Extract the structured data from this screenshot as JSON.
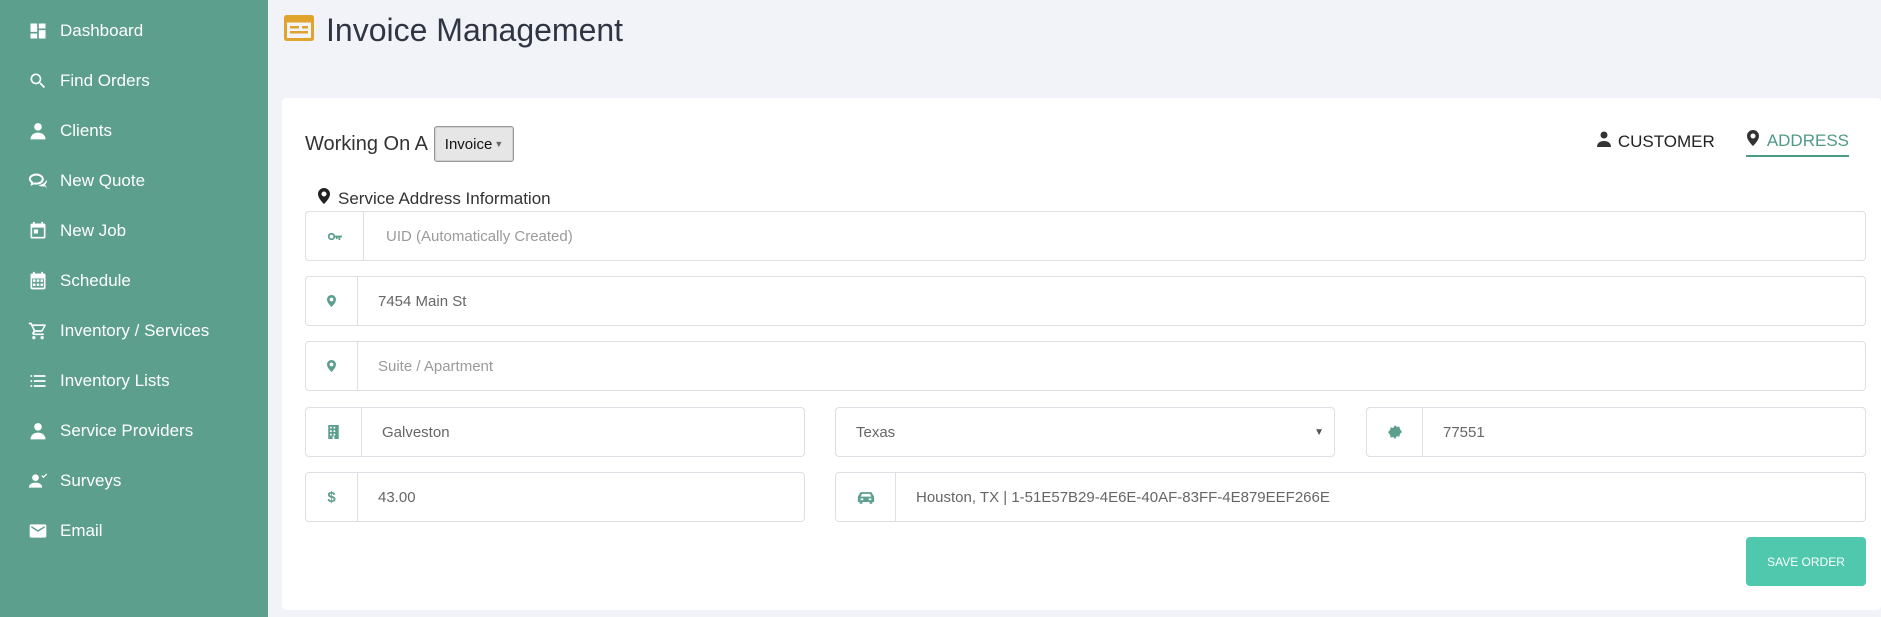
{
  "sidebar": {
    "items": [
      {
        "label": "Dashboard",
        "icon": "dashboard-icon"
      },
      {
        "label": "Find Orders",
        "icon": "search-icon"
      },
      {
        "label": "Clients",
        "icon": "person-icon"
      },
      {
        "label": "New Quote",
        "icon": "chat-icon"
      },
      {
        "label": "New Job",
        "icon": "calendar-card-icon"
      },
      {
        "label": "Schedule",
        "icon": "calendar-icon"
      },
      {
        "label": "Inventory / Services",
        "icon": "cart-icon"
      },
      {
        "label": "Inventory Lists",
        "icon": "list-icon"
      },
      {
        "label": "Service Providers",
        "icon": "person-icon"
      },
      {
        "label": "Surveys",
        "icon": "people-icon"
      },
      {
        "label": "Email",
        "icon": "envelope-icon"
      }
    ]
  },
  "header": {
    "title": "Invoice Management",
    "icon": "invoice-icon"
  },
  "form": {
    "working_label": "Working On A",
    "type_value": "Invoice",
    "tabs": {
      "customer": "CUSTOMER",
      "address": "ADDRESS"
    },
    "section_title": "Service Address Information",
    "uid_placeholder": "UID (Automatically Created)",
    "address_value": "7454 Main St",
    "suite_placeholder": "Suite / Apartment",
    "city_value": "Galveston",
    "state_value": "Texas",
    "zip_value": "77551",
    "price_value": "43.00",
    "route_value": "Houston, TX | 1-51E57B29-4E6E-40AF-83FF-4E879EEF266E",
    "save_label": "SAVE ORDER"
  },
  "colors": {
    "sidebar": "#5b9f8c",
    "accent": "#4e9b85",
    "save_button": "#4fc8ae",
    "header_icon": "#e0a32b"
  }
}
